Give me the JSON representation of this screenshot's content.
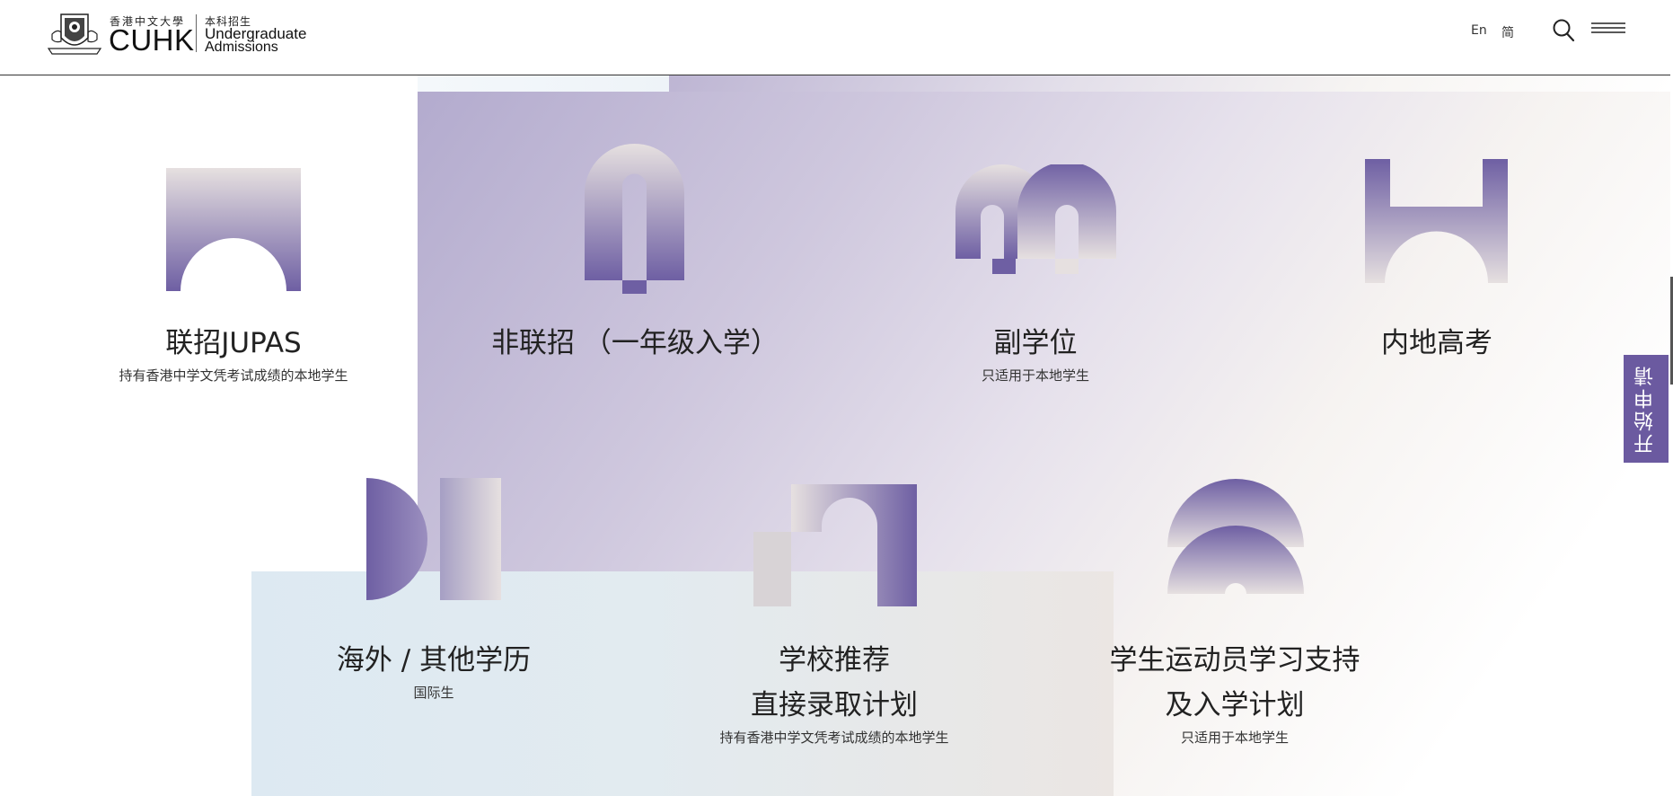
{
  "header": {
    "logo_zh": "香港中文大學",
    "logo_cuhk": "CUHK",
    "logo_sub_zh": "本科招生",
    "logo_sub_line1": "Undergraduate",
    "logo_sub_line2": "Admissions",
    "lang_en": "En",
    "lang_zh": "简"
  },
  "cards": [
    {
      "title": "联招JUPAS",
      "subtitle": "持有香港中学文凭考试成绩的本地学生"
    },
    {
      "title": "非联招 （一年级入学）",
      "subtitle": ""
    },
    {
      "title": "副学位",
      "subtitle": "只适用于本地学生"
    },
    {
      "title": "内地高考",
      "subtitle": ""
    },
    {
      "title": "海外 / 其他学历",
      "subtitle": "国际生"
    },
    {
      "title_line1": "学校推荐",
      "title_line2": "直接录取计划",
      "subtitle": "持有香港中学文凭考试成绩的本地学生"
    },
    {
      "title_line1": "学生运动员学习支持",
      "title_line2": "及入学计划",
      "subtitle": "只适用于本地学生"
    }
  ],
  "apply_button": "开始申请",
  "colors": {
    "accent_purple": "#6b5aa0",
    "light_gray": "#e4dedd",
    "light_blue": "#dde9f2"
  },
  "icons": [
    "search-icon",
    "menu-icon",
    "cuhk-crest-icon"
  ]
}
